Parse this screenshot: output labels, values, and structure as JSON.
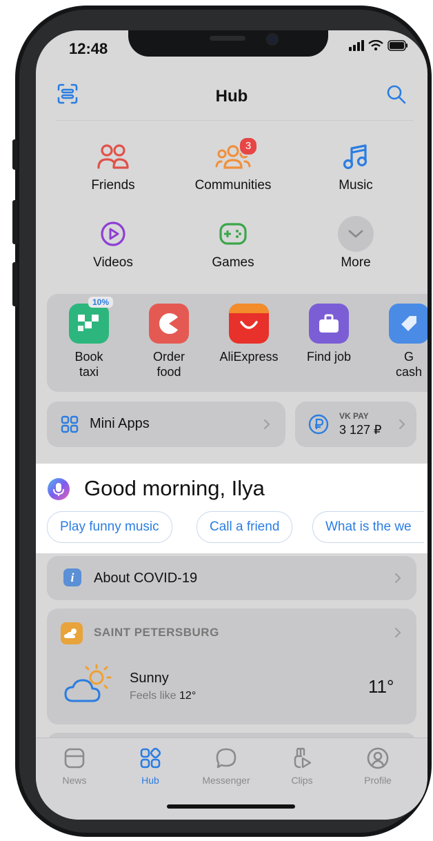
{
  "status_bar": {
    "time": "12:48"
  },
  "header": {
    "title": "Hub"
  },
  "services": [
    {
      "label": "Friends",
      "icon": "friends-icon",
      "color": "#e0524a"
    },
    {
      "label": "Communities",
      "icon": "communities-icon",
      "color": "#f0903a",
      "badge": "3"
    },
    {
      "label": "Music",
      "icon": "music-note-icon",
      "color": "#2a7de1"
    },
    {
      "label": "Videos",
      "icon": "video-play-icon",
      "color": "#8e3fd4"
    },
    {
      "label": "Games",
      "icon": "gamepad-icon",
      "color": "#3aa64a"
    },
    {
      "label": "More",
      "icon": "chevron-down-icon",
      "color": "#8a8a8e"
    }
  ],
  "mini_app_row": [
    {
      "line1": "Book",
      "line2": "taxi",
      "badge": "10%",
      "color": "#2cb67d"
    },
    {
      "line1": "Order",
      "line2": "food",
      "color": "#e45a52"
    },
    {
      "line1": "AliExpress",
      "line2": "",
      "color": "#e8312a"
    },
    {
      "line1": "Find job",
      "line2": "",
      "color": "#7b5ed6"
    },
    {
      "line1": "G",
      "line2": "cash",
      "color": "#4a8be6"
    }
  ],
  "mini_apps": {
    "label": "Mini Apps"
  },
  "vk_pay": {
    "label": "VK PAY",
    "amount": "3 127 ₽"
  },
  "assistant": {
    "greeting": "Good morning, Ilya",
    "chips": [
      "Play funny music",
      "Call a friend",
      "What is the we"
    ]
  },
  "covid": {
    "label": "About COVID-19"
  },
  "weather": {
    "city": "SAINT PETERSBURG",
    "condition": "Sunny",
    "feels_prefix": "Feels like",
    "feels_value": "12°",
    "temp": "11°"
  },
  "tabbar": [
    {
      "label": "News",
      "icon": "news-icon",
      "active": false
    },
    {
      "label": "Hub",
      "icon": "hub-icon",
      "active": true
    },
    {
      "label": "Messenger",
      "icon": "messenger-icon",
      "active": false
    },
    {
      "label": "Clips",
      "icon": "clips-icon",
      "active": false
    },
    {
      "label": "Profile",
      "icon": "profile-icon",
      "active": false
    }
  ],
  "colors": {
    "accent": "#2a7de1",
    "badge": "#e64646"
  }
}
